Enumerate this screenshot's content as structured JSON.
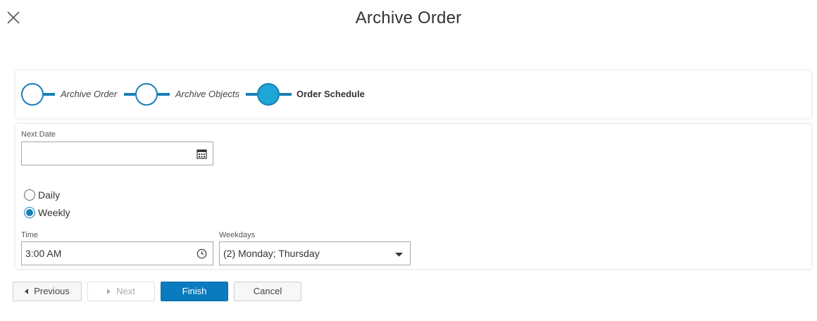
{
  "header": {
    "title": "Archive Order",
    "close_icon": "close-icon"
  },
  "stepper": {
    "steps": [
      {
        "label": "Archive Order",
        "active": false
      },
      {
        "label": "Archive Objects",
        "active": false
      },
      {
        "label": "Order Schedule",
        "active": true
      }
    ]
  },
  "form": {
    "next_date": {
      "label": "Next Date",
      "value": "",
      "icon": "calendar-icon"
    },
    "frequency": {
      "options": [
        {
          "label": "Daily",
          "checked": false
        },
        {
          "label": "Weekly",
          "checked": true
        }
      ]
    },
    "time": {
      "label": "Time",
      "value": "3:00 AM",
      "icon": "clock-icon"
    },
    "weekdays": {
      "label": "Weekdays",
      "value": "(2) Monday; Thursday",
      "icon": "dropdown-arrow-icon"
    }
  },
  "footer": {
    "previous_label": "Previous",
    "next_label": "Next",
    "finish_label": "Finish",
    "cancel_label": "Cancel"
  },
  "colors": {
    "accent": "#1a7fb5",
    "active_step": "#1ea7d6",
    "primary_button": "#0a7bbf"
  }
}
